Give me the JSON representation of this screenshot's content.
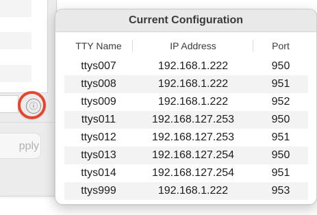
{
  "background_window": {
    "apply_label": "pply",
    "info_icon_glyph": "ⓘ"
  },
  "popover": {
    "title": "Current Configuration",
    "columns": [
      "TTY Name",
      "IP Address",
      "Port"
    ],
    "rows": [
      [
        "ttys007",
        "192.168.1.222",
        "950"
      ],
      [
        "ttys008",
        "192.168.1.222",
        "951"
      ],
      [
        "ttys009",
        "192.168.1.222",
        "952"
      ],
      [
        "ttys011",
        "192.168.127.253",
        "950"
      ],
      [
        "ttys012",
        "192.168.127.253",
        "951"
      ],
      [
        "ttys013",
        "192.168.127.254",
        "950"
      ],
      [
        "ttys014",
        "192.168.127.254",
        "951"
      ],
      [
        "ttys999",
        "192.168.1.222",
        "953"
      ]
    ]
  },
  "colors": {
    "highlight_ring": "#e8432d",
    "title_bar": "#e9e9e9",
    "row_stripe": "#f3f3f3"
  }
}
